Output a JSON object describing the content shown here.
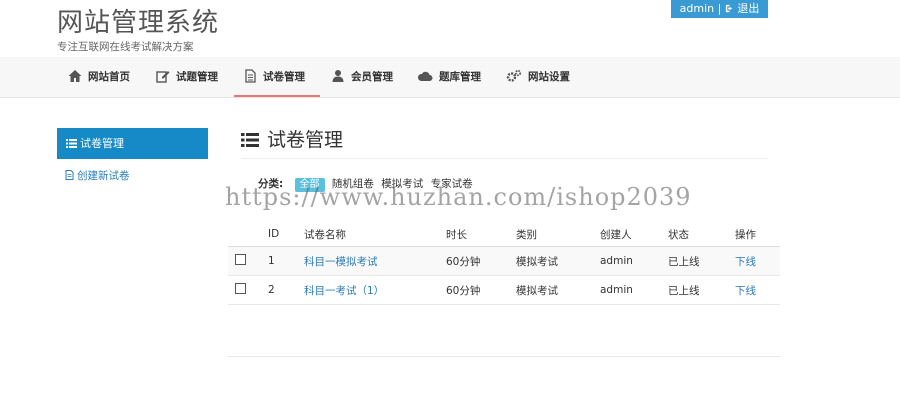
{
  "header": {
    "title": "网站管理系统",
    "subtitle": "专注互联网在线考试解决方案",
    "user": "admin",
    "separator": "|",
    "logout": "退出"
  },
  "nav": [
    {
      "label": "网站首页",
      "icon": "home-icon"
    },
    {
      "label": "试题管理",
      "icon": "edit-icon"
    },
    {
      "label": "试卷管理",
      "icon": "document-icon",
      "active": true
    },
    {
      "label": "会员管理",
      "icon": "user-icon"
    },
    {
      "label": "题库管理",
      "icon": "cloud-icon"
    },
    {
      "label": "网站设置",
      "icon": "gears-icon"
    }
  ],
  "sidebar": {
    "active": "试卷管理",
    "link": "创建新试卷"
  },
  "main": {
    "heading": "试卷管理",
    "category_label": "分类:",
    "categories": [
      "全部",
      "随机组卷",
      "模拟考试",
      "专家试卷"
    ],
    "columns": [
      "ID",
      "试卷名称",
      "时长",
      "类别",
      "创建人",
      "状态",
      "操作"
    ],
    "rows": [
      {
        "id": "1",
        "name": "科目一模拟考试",
        "duration": "60分钟",
        "type": "模拟考试",
        "creator": "admin",
        "status": "已上线",
        "action": "下线"
      },
      {
        "id": "2",
        "name": "科目一考试（1）",
        "duration": "60分钟",
        "type": "模拟考试",
        "creator": "admin",
        "status": "已上线",
        "action": "下线"
      }
    ]
  },
  "watermark": "https://www.huzhan.com/ishop2039",
  "colors": {
    "accent": "#168ac6",
    "active_tab": "#e8776f",
    "pill": "#5bc0de",
    "link": "#2b7bb9"
  }
}
